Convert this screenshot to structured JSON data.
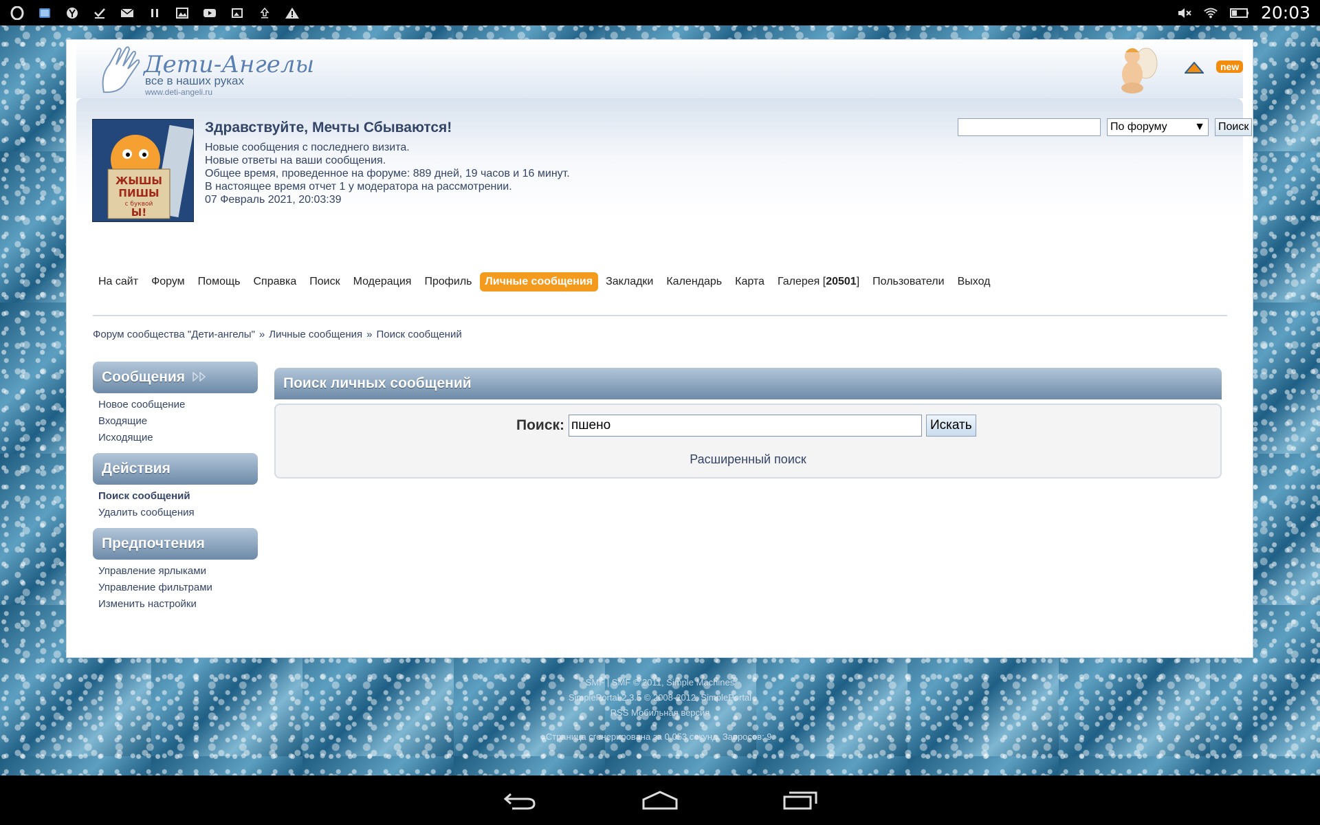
{
  "statusbar": {
    "time": "20:03",
    "left_icons": [
      "opera-icon",
      "image-icon",
      "yandex-icon",
      "download-done-icon",
      "mail-icon",
      "pause-icon",
      "gallery-icon",
      "youtube-icon",
      "photo-icon",
      "upload-icon",
      "warning-icon"
    ],
    "right_icons": [
      "mute-icon",
      "wifi-icon",
      "battery-icon"
    ]
  },
  "header": {
    "logo_title": "Дети-Ангелы",
    "logo_subtitle": "все в наших руках",
    "logo_url": "www.deti-angeli.ru",
    "new_badge": "new"
  },
  "user": {
    "greeting": "Здравствуйте, Мечты Сбываются!",
    "lines": [
      "Новые сообщения с последнего визита.",
      "Новые ответы на ваши сообщения.",
      "Общее время, проведенное на форуме: 889 дней, 19 часов и 16 минут.",
      "В настоящее время отчет 1 у модератора на рассмотрении.",
      "07 Февраль 2021, 20:03:39"
    ],
    "avatar_text": "ЖЫШЫ ПИШЫ с буквой Ы!"
  },
  "top_search": {
    "value": "",
    "scope": "По форуму",
    "button": "Поиск"
  },
  "menu": {
    "items": [
      "На сайт",
      "Форум",
      "Помощь",
      "Справка",
      "Поиск",
      "Модерация",
      "Профиль",
      "Личные сообщения",
      "Закладки",
      "Календарь",
      "Карта"
    ],
    "gallery_label": "Галерея [",
    "gallery_count": "20501",
    "gallery_close": "]",
    "items_after": [
      "Пользователи",
      "Выход"
    ]
  },
  "breadcrumb": {
    "items": [
      "Форум сообщества \"Дети-ангелы\"",
      "Личные сообщения",
      "Поиск сообщений"
    ],
    "separator": "»"
  },
  "sidebar": {
    "sections": [
      {
        "title": "Сообщения",
        "items": [
          "Новое сообщение",
          "Входящие",
          "Исходящие"
        ]
      },
      {
        "title": "Действия",
        "items": [
          "Поиск сообщений",
          "Удалить сообщения"
        ]
      },
      {
        "title": "Предпочтения",
        "items": [
          "Управление ярлыками",
          "Управление фильтрами",
          "Изменить настройки"
        ]
      }
    ]
  },
  "main": {
    "title": "Поиск личных сообщений",
    "search_label": "Поиск:",
    "search_value": "пшено",
    "search_button": "Искать",
    "advanced_link": "Расширенный поиск"
  },
  "footer": {
    "line1": "SMF | SMF © 2011, Simple Machines",
    "line2": "SimplePortal 2.3.5 © 2008-2012, SimplePortal",
    "line3": "RSS   Мобильная версия",
    "line4": "Страница сгенерирована за 0.053 секунд. Запросов: 9."
  },
  "colors": {
    "accent": "#f49a1c",
    "catbar": "#6d8aa8",
    "text": "#334466"
  }
}
